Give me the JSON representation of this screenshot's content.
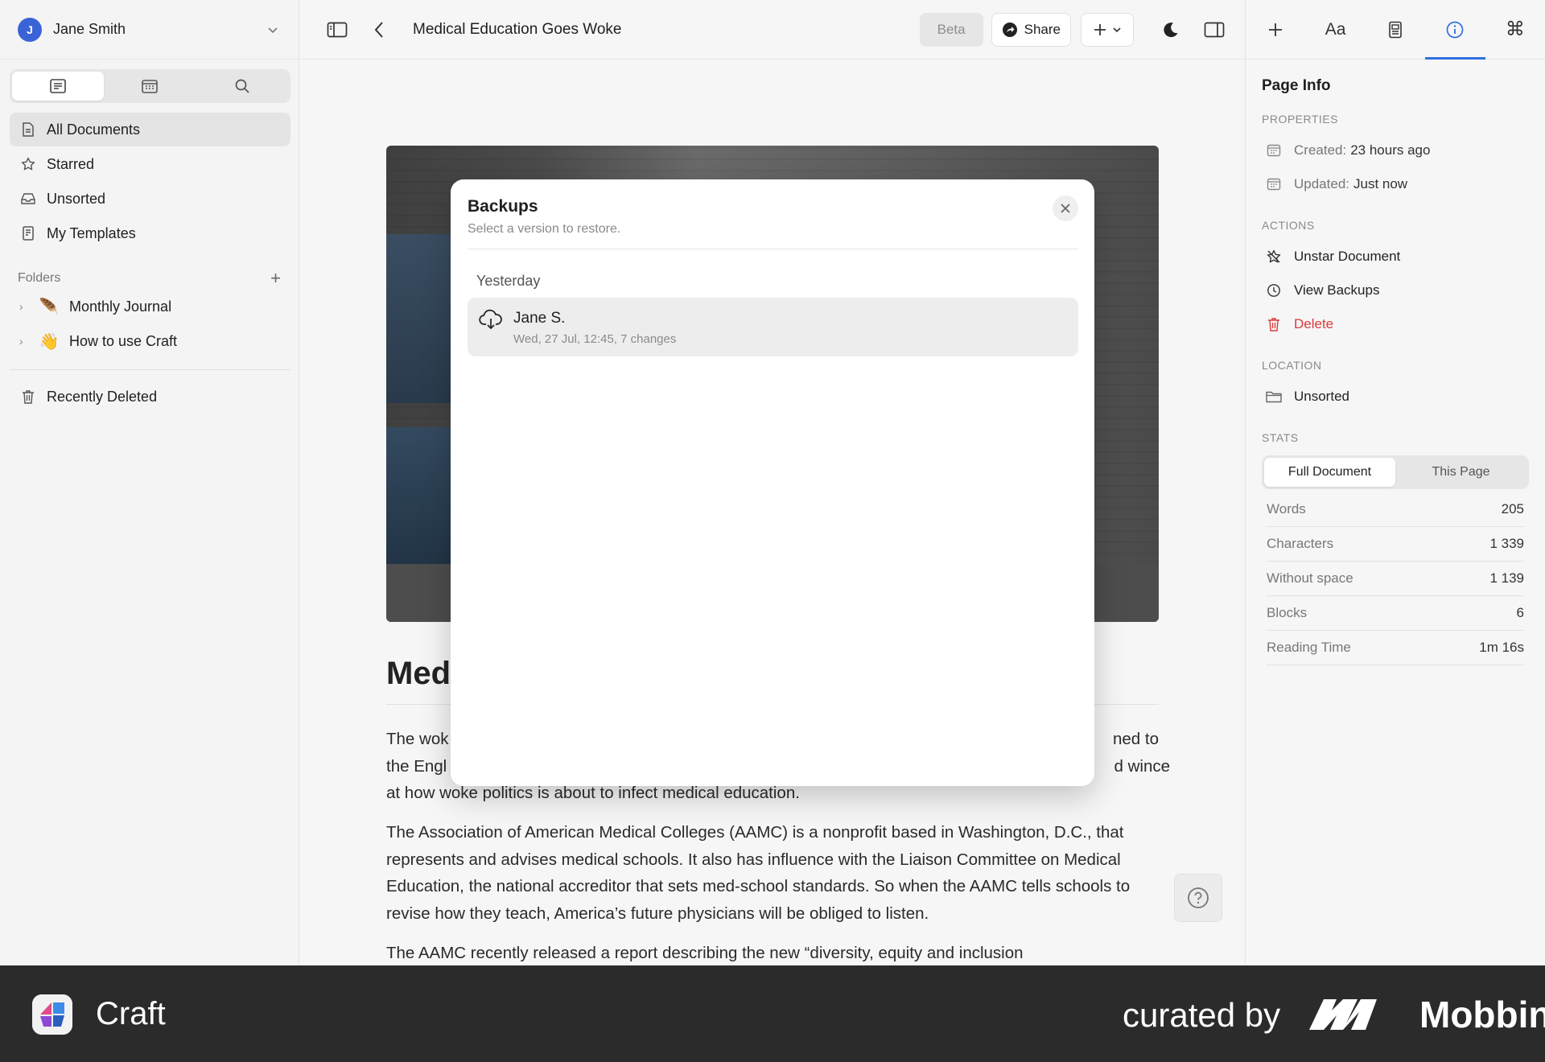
{
  "user": {
    "initial": "J",
    "name": "Jane Smith"
  },
  "sidebar": {
    "nav": [
      {
        "label": "All Documents",
        "icon": "document-icon"
      },
      {
        "label": "Starred",
        "icon": "star-icon"
      },
      {
        "label": "Unsorted",
        "icon": "inbox-icon"
      },
      {
        "label": "My Templates",
        "icon": "template-icon"
      }
    ],
    "folders_label": "Folders",
    "folders": [
      {
        "label": "Monthly Journal",
        "emoji": "🪶"
      },
      {
        "label": "How to use Craft",
        "emoji": "👋"
      }
    ],
    "recently_deleted": "Recently Deleted"
  },
  "topbar": {
    "title": "Medical Education Goes Woke",
    "beta": "Beta",
    "share": "Share"
  },
  "document": {
    "heading": "Med",
    "para1_line1_start": "The wok",
    "para1_line1_end": "ned to",
    "para1_line2_start": "the Engl",
    "para1_line2_end": "d wince",
    "para1_line3": "at how woke politics is about to infect medical education.",
    "para2": "The Association of American Medical Colleges (AAMC) is a nonprofit based in Washington, D.C., that represents and advises medical schools. It also has influence with the Liaison Committee on Medical Education, the national accreditor that sets med-school standards. So when the AAMC tells schools to revise how they teach, America’s future physicians will be obliged to listen.",
    "para3": "The AAMC recently released a report describing the new “diversity, equity and inclusion"
  },
  "modal": {
    "title": "Backups",
    "subtitle": "Select a version to restore.",
    "group": "Yesterday",
    "item_name": "Jane S.",
    "item_meta": "Wed, 27 Jul, 12:45, 7 changes"
  },
  "right_panel": {
    "title": "Page Info",
    "properties_label": "PROPERTIES",
    "created_label": "Created:",
    "created_value": "23 hours ago",
    "updated_label": "Updated:",
    "updated_value": "Just now",
    "actions_label": "ACTIONS",
    "unstar": "Unstar Document",
    "view_backups": "View Backups",
    "delete": "Delete",
    "location_label": "LOCATION",
    "location_value": "Unsorted",
    "stats_label": "STATS",
    "stats_tabs": [
      "Full Document",
      "This Page"
    ],
    "stats": [
      {
        "label": "Words",
        "value": "205"
      },
      {
        "label": "Characters",
        "value": "1 339"
      },
      {
        "label": "Without space",
        "value": "1 139"
      },
      {
        "label": "Blocks",
        "value": "6"
      },
      {
        "label": "Reading Time",
        "value": "1m 16s"
      }
    ]
  },
  "footer": {
    "app_name": "Craft",
    "curated_by": "curated by",
    "brand": "Mobbin"
  },
  "colors": {
    "accent": "#2f6fdf",
    "danger": "#d93a3a",
    "footer_bg": "#2b2b2b"
  }
}
